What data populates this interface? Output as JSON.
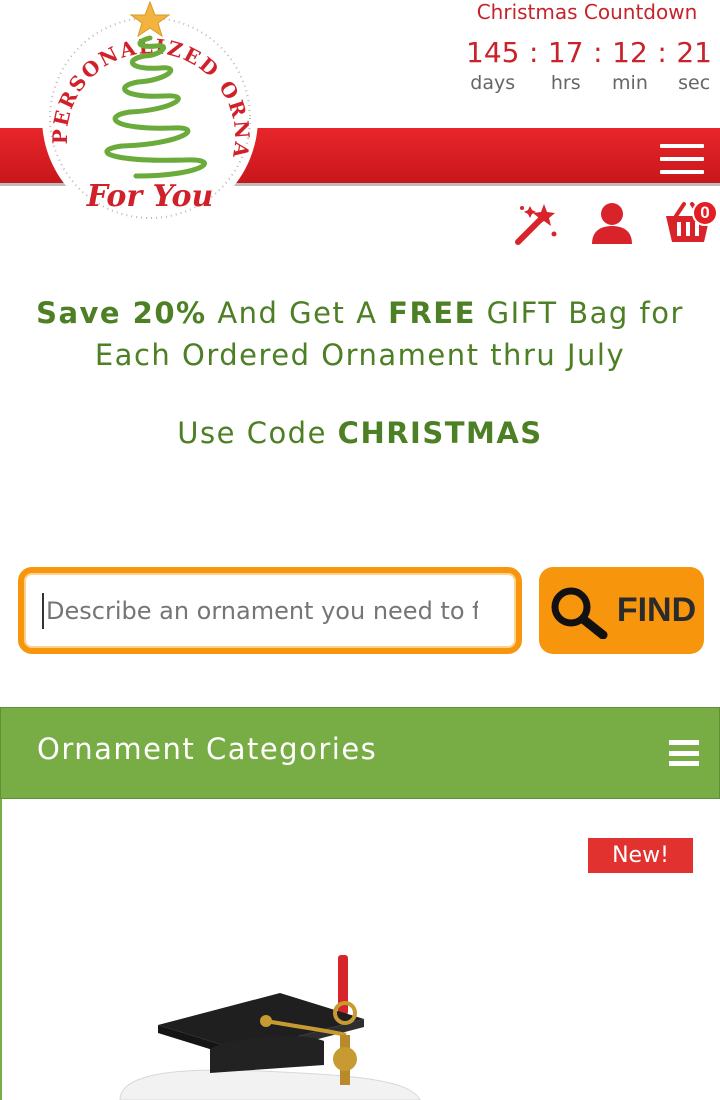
{
  "logo": {
    "arc_text": "PERSONALIZED ORNAMENTS",
    "tagline": "For You"
  },
  "countdown": {
    "title": "Christmas Countdown",
    "units": [
      {
        "value": "145",
        "label": "days"
      },
      {
        "value": "17",
        "label": "hrs"
      },
      {
        "value": "12",
        "label": "min"
      },
      {
        "value": "21",
        "label": "sec"
      }
    ],
    "separator": ":"
  },
  "header_icons": {
    "wizard": "magic-wand-icon",
    "account": "user-icon",
    "cart": "cart-icon",
    "cart_count": "0"
  },
  "promo": {
    "line1_bold1": "Save 20%",
    "line1_mid": " And Get A ",
    "line1_bold2": "FREE",
    "line1_end": " GIFT Bag for",
    "line2": "Each Ordered Ornament thru July",
    "code_prefix": "Use Code ",
    "code": "CHRISTMAS"
  },
  "search": {
    "placeholder": "Describe an ornament you need to find",
    "button_label": "FIND"
  },
  "categories": {
    "title": "Ornament Categories"
  },
  "product": {
    "badge": "New!"
  },
  "colors": {
    "brand_red": "#c8222a",
    "band_red": "#e8262a",
    "promo_green": "#4d7f24",
    "category_green": "#78ac45",
    "search_orange": "#f7950d"
  }
}
